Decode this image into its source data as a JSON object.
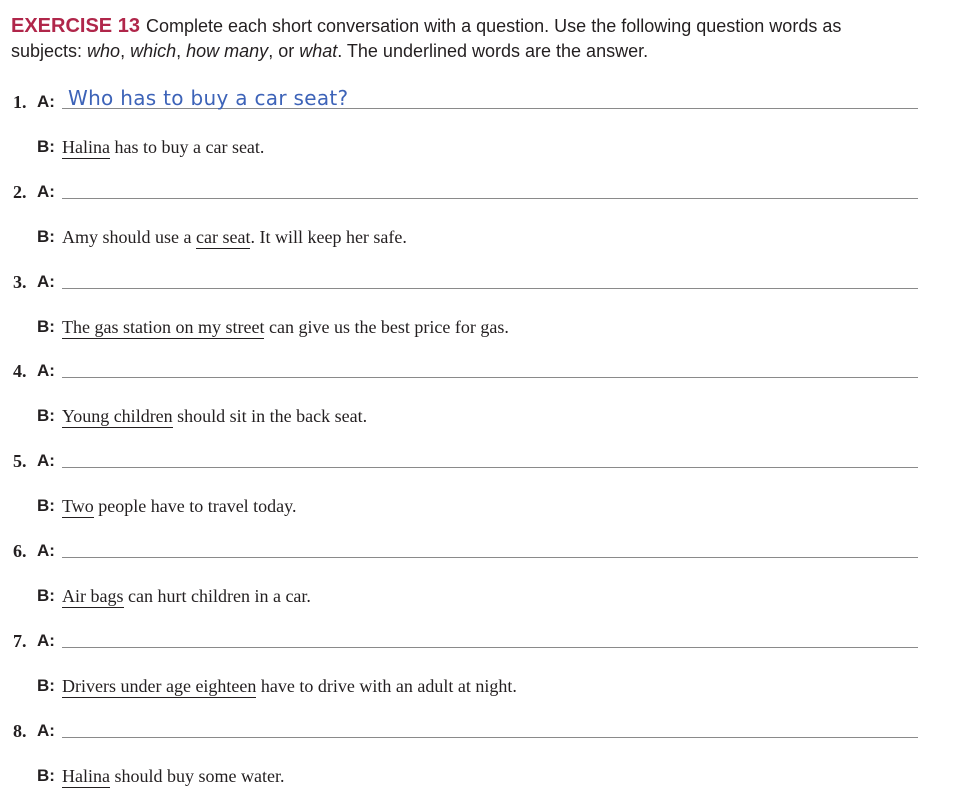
{
  "exercise": {
    "title": "EXERCISE 13",
    "instr_1": "Complete each short conversation with a question. Use the following question words as subjects: ",
    "w1": "who",
    "s1": ", ",
    "w2": "which",
    "s2": ", ",
    "w3": "how many",
    "s3": ", or ",
    "w4": "what",
    "instr_2": ". The underlined words are the answer."
  },
  "speaker_a": "A:",
  "speaker_b": "B:",
  "items": [
    {
      "number": "1.",
      "answer": "Who has to buy a car seat?",
      "b_pre": "",
      "b_underlined": "Halina",
      "b_post": " has to buy a car seat."
    },
    {
      "number": "2.",
      "answer": "",
      "b_pre": "Amy should use a ",
      "b_underlined": "car seat",
      "b_post": ". It will keep her safe."
    },
    {
      "number": "3.",
      "answer": "",
      "b_pre": "",
      "b_underlined": "The gas station on my street",
      "b_post": " can give us the best price for gas."
    },
    {
      "number": "4.",
      "answer": "",
      "b_pre": "",
      "b_underlined": "Young children",
      "b_post": " should sit in the back seat."
    },
    {
      "number": "5.",
      "answer": "",
      "b_pre": "",
      "b_underlined": "Two",
      "b_post": " people have to travel today."
    },
    {
      "number": "6.",
      "answer": "",
      "b_pre": "",
      "b_underlined": "Air bags",
      "b_post": " can hurt children in a car."
    },
    {
      "number": "7.",
      "answer": "",
      "b_pre": "",
      "b_underlined": "Drivers under age eighteen",
      "b_post": " have to drive with an adult at night."
    },
    {
      "number": "8.",
      "answer": "",
      "b_pre": "",
      "b_underlined": "Halina",
      "b_post": " should buy some water."
    }
  ],
  "colors": {
    "title": "#b0264a",
    "handwriting": "#3d63b8",
    "text": "#231f20"
  }
}
